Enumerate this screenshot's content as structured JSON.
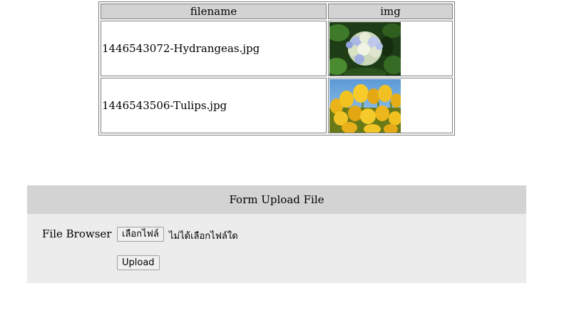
{
  "table": {
    "headers": {
      "filename": "filename",
      "img": "img"
    },
    "rows": [
      {
        "filename": "1446543072-Hydrangeas.jpg",
        "image": "hydrangeas-photo"
      },
      {
        "filename": "1446543506-Tulips.jpg",
        "image": "tulips-photo"
      }
    ]
  },
  "form": {
    "title": "Form Upload File",
    "file_label": "File Browser",
    "choose_button": "เลือกไฟล์",
    "no_file_text": "ไม่ได้เลือกไฟล์ใด",
    "upload_button": "Upload"
  }
}
